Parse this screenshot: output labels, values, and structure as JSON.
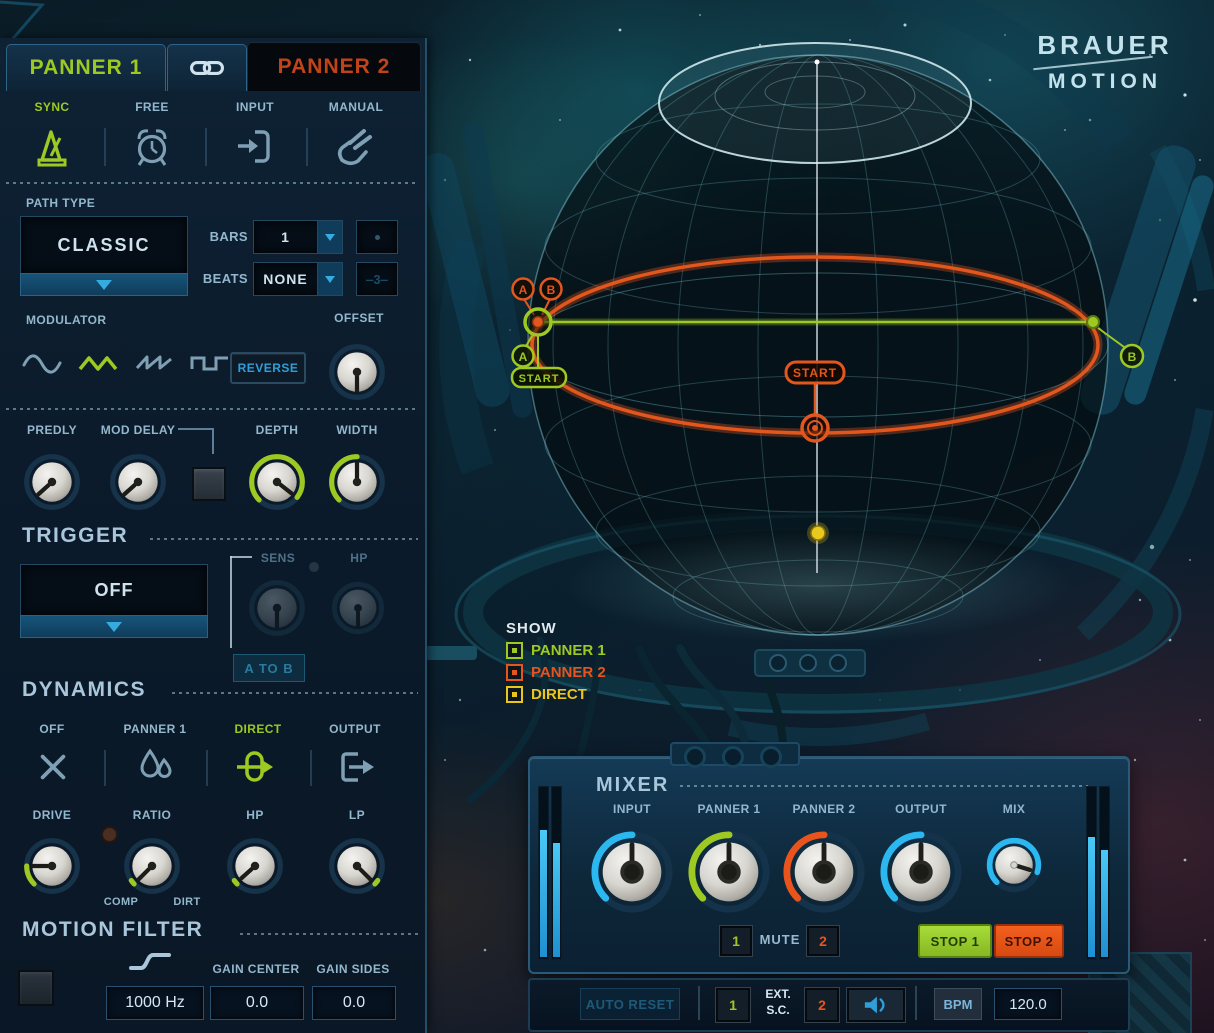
{
  "brand": {
    "line1": "BRAUER",
    "line2": "MOTION"
  },
  "tabs": {
    "panner1": "PANNER 1",
    "panner2": "PANNER 2"
  },
  "modes": {
    "sync": "SYNC",
    "free": "FREE",
    "input": "INPUT",
    "manual": "MANUAL"
  },
  "path": {
    "label": "PATH TYPE",
    "value": "CLASSIC",
    "bars_label": "BARS",
    "bars_value": "1",
    "beats_label": "BEATS",
    "beats_value": "NONE"
  },
  "modulator": {
    "label": "MODULATOR",
    "reverse": "REVERSE",
    "offset": "OFFSET"
  },
  "delay": {
    "predly": "PREDLY",
    "mod_delay": "MOD DELAY",
    "depth": "DEPTH",
    "width": "WIDTH"
  },
  "trigger": {
    "label": "TRIGGER",
    "value": "OFF",
    "sens": "SENS",
    "hp": "HP",
    "a_to_b": "A TO B"
  },
  "dynamics": {
    "label": "DYNAMICS",
    "off": "OFF",
    "panner1": "PANNER 1",
    "direct": "DIRECT",
    "output": "OUTPUT",
    "drive": "DRIVE",
    "ratio": "RATIO",
    "hp": "HP",
    "lp": "LP",
    "comp": "COMP",
    "dirt": "DIRT"
  },
  "motion_filter": {
    "label": "MOTION FILTER",
    "freq": "1000 Hz",
    "gain_center_label": "GAIN CENTER",
    "gain_center": "0.0",
    "gain_sides_label": "GAIN SIDES",
    "gain_sides": "0.0"
  },
  "sphere": {
    "a": "A",
    "b": "B",
    "start": "START"
  },
  "show": {
    "label": "SHOW",
    "items": [
      {
        "label": "PANNER 1",
        "color": "#9dc922"
      },
      {
        "label": "PANNER 2",
        "color": "#e8541c"
      },
      {
        "label": "DIRECT",
        "color": "#e8c61c"
      }
    ]
  },
  "mixer": {
    "label": "MIXER",
    "input": "INPUT",
    "panner1": "PANNER 1",
    "panner2": "PANNER 2",
    "output": "OUTPUT",
    "mix": "MIX",
    "mute": "MUTE",
    "mute1": "1",
    "mute2": "2",
    "stop1": "STOP 1",
    "stop2": "STOP 2"
  },
  "transport": {
    "auto_reset": "AUTO RESET",
    "sc1": "1",
    "ext": "EXT.",
    "sc": "S.C.",
    "sc2": "2",
    "bpm": "BPM",
    "bpm_value": "120.0"
  },
  "colors": {
    "green": "#9dc922",
    "orange": "#e8541c",
    "yellow": "#e8c61c",
    "blue": "#2aa3e0",
    "panner2_text": "#c24318"
  }
}
